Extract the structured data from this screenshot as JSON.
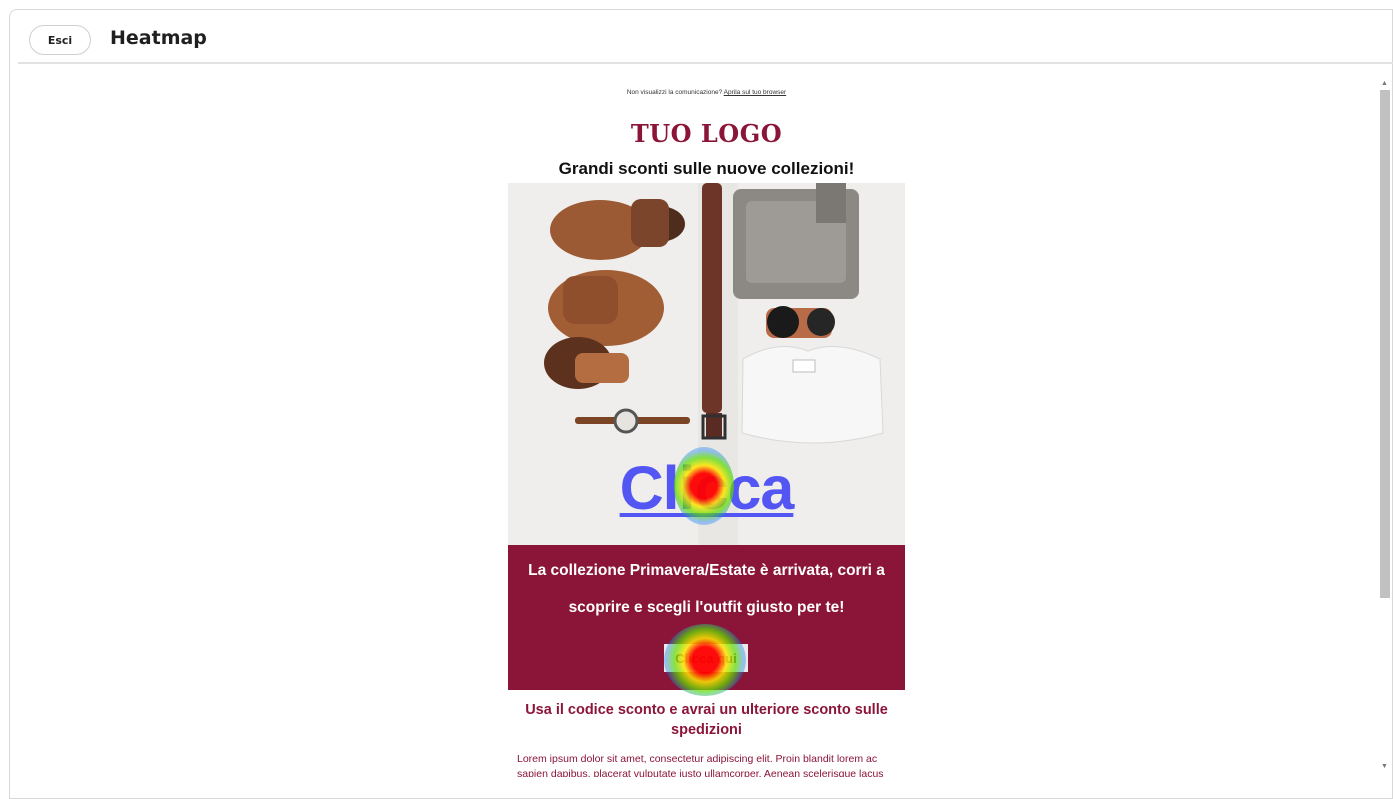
{
  "header": {
    "exit_label": "Esci",
    "title": "Heatmap"
  },
  "email": {
    "preheader_text": "Non visualizzi la comunicazione?",
    "preheader_link": "Aprila sul tuo browser",
    "logo": "TUO LOGO",
    "headline": "Grandi sconti sulle nuove collezioni!",
    "hero_cta": "Clicca",
    "promo_text": "La collezione Primavera/Estate è arrivata, corri a scoprire e scegli l'outfit giusto per te!",
    "promo_button": "Clicca qui",
    "code_title": "Usa il codice sconto e avrai un ulteriore sconto sulle spedizioni",
    "body_text": "Lorem ipsum dolor sit amet, consectetur adipiscing elit. Proin blandit lorem ac sapien dapibus, placerat vulputate justo ullamcorper. Aenean scelerisque lacus"
  },
  "colors": {
    "brand": "#8b1538",
    "link": "#5356f2"
  }
}
